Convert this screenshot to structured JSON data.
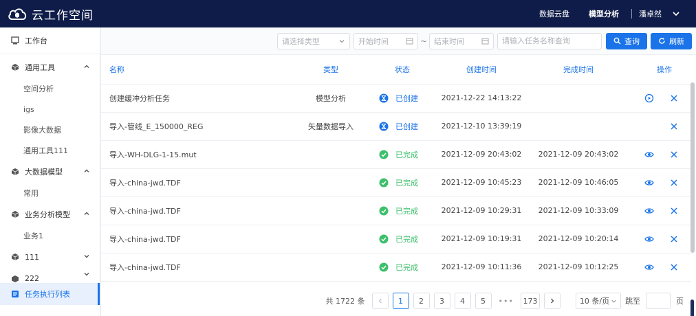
{
  "app": {
    "title": "云工作空间"
  },
  "topnav": {
    "items": [
      "数据云盘",
      "模型分析"
    ],
    "user": "潘卓然"
  },
  "sidebar": {
    "workbench": "工作台",
    "groups": [
      {
        "label": "通用工具",
        "children": [
          "空间分析",
          "igs",
          "影像大数据",
          "通用工具111"
        ]
      },
      {
        "label": "大数据模型",
        "children": [
          "常用"
        ]
      },
      {
        "label": "业务分析模型",
        "children": [
          "业务1"
        ]
      },
      {
        "label": "111",
        "children": []
      },
      {
        "label": "222",
        "children": []
      }
    ],
    "active": "任务执行列表"
  },
  "filters": {
    "type_placeholder": "请选择类型",
    "start_placeholder": "开始时间",
    "end_placeholder": "结束时间",
    "search_placeholder": "请输入任务名称查询",
    "query_label": "查询",
    "refresh_label": "刷新"
  },
  "table": {
    "headers": {
      "name": "名称",
      "type": "类型",
      "status": "状态",
      "created": "创建时间",
      "finished": "完成时间",
      "ops": "操作"
    },
    "rows": [
      {
        "name": "创建缓冲分析任务",
        "type": "模型分析",
        "status": "已创建",
        "created": "2021-12-22 14:13:22",
        "finished": ""
      },
      {
        "name": "导入-管线_E_150000_REG",
        "type": "矢量数据导入",
        "status": "已创建",
        "created": "2021-12-10 13:39:19",
        "finished": ""
      },
      {
        "name": "导入-WH-DLG-1-15.mut",
        "type": "",
        "status": "已完成",
        "created": "2021-12-09 20:43:02",
        "finished": "2021-12-09 20:43:02"
      },
      {
        "name": "导入-china-jwd.TDF",
        "type": "",
        "status": "已完成",
        "created": "2021-12-09 10:45:23",
        "finished": "2021-12-09 10:46:05"
      },
      {
        "name": "导入-china-jwd.TDF",
        "type": "",
        "status": "已完成",
        "created": "2021-12-09 10:29:31",
        "finished": "2021-12-09 10:33:09"
      },
      {
        "name": "导入-china-jwd.TDF",
        "type": "",
        "status": "已完成",
        "created": "2021-12-09 10:19:31",
        "finished": "2021-12-09 10:20:14"
      },
      {
        "name": "导入-china-jwd.TDF",
        "type": "",
        "status": "已完成",
        "created": "2021-12-09 10:11:36",
        "finished": "2021-12-09 10:12:25"
      }
    ]
  },
  "pager": {
    "total": "共 1722 条",
    "pages": [
      "1",
      "2",
      "3",
      "4",
      "5"
    ],
    "last": "173",
    "page_size": "10 条/页",
    "goto_label": "跳至",
    "page_unit": "页"
  },
  "colors": {
    "header_bg": "#0f1c49",
    "accent": "#1a73e8",
    "success": "#3dbf6b"
  }
}
